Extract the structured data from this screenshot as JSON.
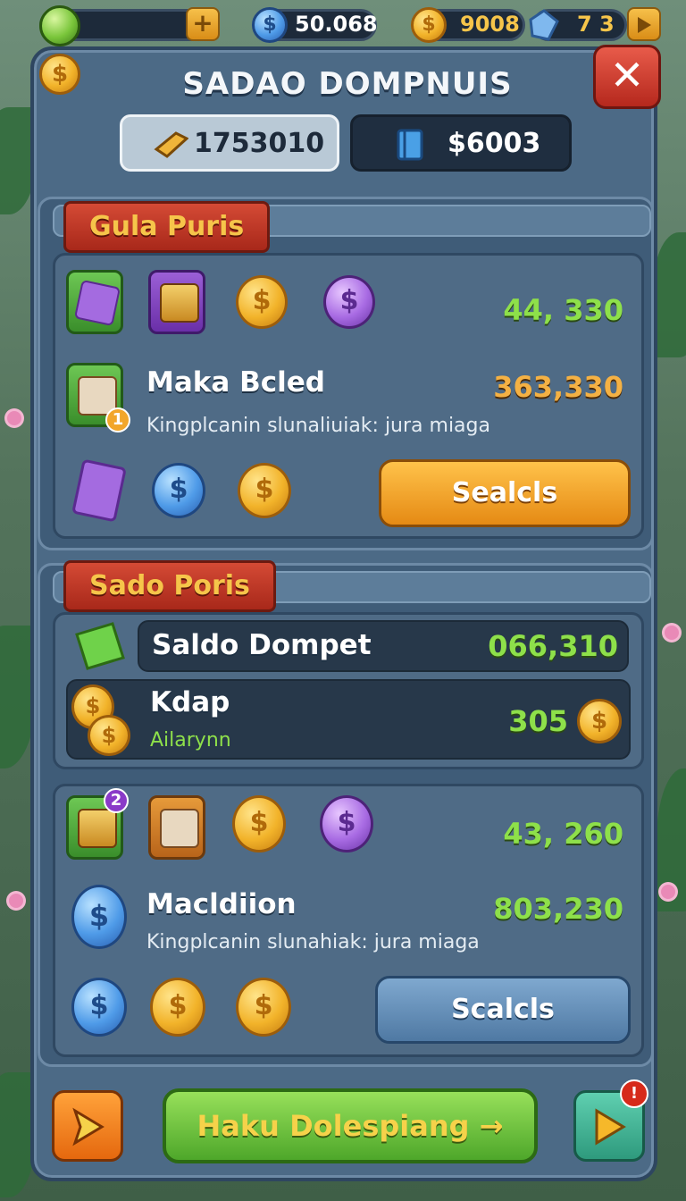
{
  "hud": {
    "value_1": "50.068",
    "value_2": "9008",
    "value_3": "7 3",
    "plus_icon": "plus-icon",
    "arrow_icon": "play-arrow-icon"
  },
  "panel": {
    "title": "SADAO DOMPNUIS",
    "stat_1": "1753010",
    "stat_2": "$6003"
  },
  "section_1": {
    "tag": "Gula Puris",
    "row_1_value": "44, 330",
    "row_2": {
      "title": "Maka Bcled",
      "desc": "Kingplcanin slunaliuiak: jura miaga",
      "value": "363,330"
    },
    "button": "Sealcls"
  },
  "section_2": {
    "tag": "Sado Poris",
    "dark_row_1": {
      "label": "Saldo Dompet",
      "value": "066,310"
    },
    "dark_row_2": {
      "title": "Kdap",
      "sub": "Ailarynn",
      "value": "305"
    },
    "row_1_value": "43, 260",
    "row_2": {
      "title": "Macldiion",
      "desc": "Kingplcanin slunahiak: jura miaga",
      "value": "803,230"
    },
    "button": "Scalcls"
  },
  "footer": {
    "main_button": "Haku Dolespiang",
    "badge": "!"
  },
  "colors": {
    "panel": "#4c6a86",
    "accent_orange": "#e58a14",
    "accent_green": "#4ea72a",
    "value_green": "#8ee04a",
    "value_orange": "#f4b144",
    "close_red": "#b5281d"
  }
}
